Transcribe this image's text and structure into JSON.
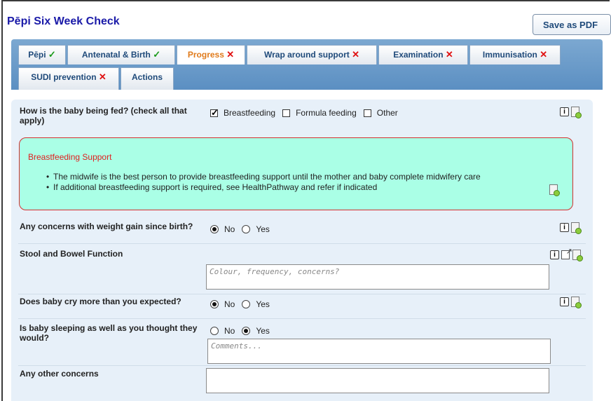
{
  "header": {
    "title": "Pēpi Six Week Check",
    "save_button": "Save as PDF"
  },
  "tabs": [
    {
      "label": "Pēpi",
      "status": "✓"
    },
    {
      "label": "Antenatal & Birth",
      "status": "✓"
    },
    {
      "label": "Progress",
      "status": "✕"
    },
    {
      "label": "Wrap around support",
      "status": "✕"
    },
    {
      "label": "Examination",
      "status": "✕"
    },
    {
      "label": "Immunisation",
      "status": "✕"
    },
    {
      "label": "SUDI prevention",
      "status": "✕"
    },
    {
      "label": "Actions",
      "status": ""
    }
  ],
  "feeding": {
    "question": "How is the baby being fed? (check all that apply)",
    "options": [
      {
        "label": "Breastfeeding",
        "checked": true
      },
      {
        "label": "Formula feeding",
        "checked": false
      },
      {
        "label": "Other",
        "checked": false
      }
    ]
  },
  "support": {
    "title": "Breastfeeding Support",
    "bullets": [
      "The midwife is the best person to provide breastfeeding support until the mother and baby complete midwifery care",
      "If additional breastfeeding support is required, see HealthPathway and refer if indicated"
    ]
  },
  "weight": {
    "question": "Any concerns with weight gain since birth?",
    "no": "No",
    "yes": "Yes",
    "selected": "No"
  },
  "stool": {
    "question": "Stool and Bowel Function",
    "placeholder": "Colour, frequency, concerns?"
  },
  "cry": {
    "question": "Does baby cry more than you expected?",
    "no": "No",
    "yes": "Yes",
    "selected": "No"
  },
  "sleep": {
    "question": "Is baby sleeping as well as you thought they would?",
    "no": "No",
    "yes": "Yes",
    "selected": "Yes",
    "placeholder": "Comments..."
  },
  "other": {
    "question": "Any other concerns",
    "value": ""
  },
  "colors": {
    "title": "#1a1aa8",
    "active_tab": "#e07a1a",
    "ok": "#1a9a1a",
    "bad": "#e01010",
    "panel": "#e7f0f9",
    "support_bg": "#aaffe6"
  },
  "icons": [
    "info-icon",
    "add-note-icon",
    "popout-icon",
    "checkmark-icon",
    "cross-icon"
  ]
}
